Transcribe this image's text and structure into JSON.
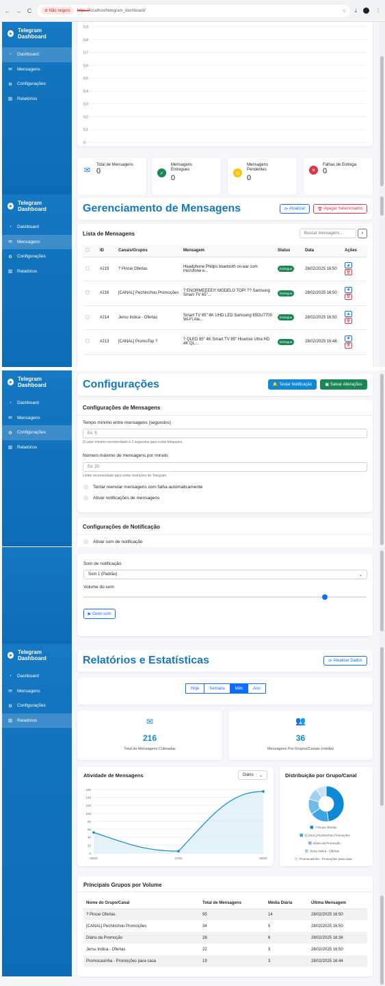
{
  "browser": {
    "not_secure": "Não seguro",
    "url_scheme": "https://",
    "url_rest": "localhost/telegram_dashboard/"
  },
  "sidebar": {
    "brand": "Telegram Dashboard",
    "items": [
      {
        "label": "Dashboard",
        "icon": "gauge-icon"
      },
      {
        "label": "Mensagens",
        "icon": "envelope-icon"
      },
      {
        "label": "Configurações",
        "icon": "gear-icon"
      },
      {
        "label": "Relatórios",
        "icon": "chart-icon"
      }
    ]
  },
  "dashboard": {
    "chart_data": {
      "type": "line",
      "y_ticks": [
        "0,9",
        "0,8",
        "0,7",
        "0,6",
        "0,5",
        "0,4",
        "0,3",
        "0,2",
        "0,1",
        "0"
      ],
      "ylim": [
        0,
        0.9
      ],
      "series": []
    },
    "stats": [
      {
        "label": "Total de Mensagens",
        "value": "0",
        "icon": "envelope-icon",
        "color": "#0d6efd"
      },
      {
        "label": "Mensagens Entregues",
        "value": "0",
        "icon": "check-icon",
        "color": "#198754"
      },
      {
        "label": "Mensagens Pendentes",
        "value": "0",
        "icon": "clock-icon",
        "color": "#ffc107"
      },
      {
        "label": "Falhas de Entrega",
        "value": "0",
        "icon": "x-icon",
        "color": "#dc3545"
      }
    ]
  },
  "messages": {
    "title": "Gerenciamento de Mensagens",
    "refresh_label": "Atualizar",
    "delete_selected_label": "Apagar Selecionados",
    "list_title": "Lista de Mensagens",
    "search_placeholder": "Buscar mensagens...",
    "columns": [
      "ID",
      "Canais/Grupos",
      "Mensagem",
      "Status",
      "Data",
      "Ações"
    ],
    "rows": [
      {
        "id": "#215",
        "channel": "? Pincei Ofertas",
        "message": "Headphone Philips bluetooth on-ear com microfone e...",
        "status": "Entregue",
        "date": "28/02/2025 16:50"
      },
      {
        "id": "#216",
        "channel": "[CANAL] Pechinchou Promoções",
        "message": "? ENORMEEEE!!! MODELO TOP! ?? Samsung Smart TV 65\"...",
        "status": "Entregue",
        "date": "28/02/2025 16:50"
      },
      {
        "id": "#214",
        "channel": "Jersu Indica - Ofertas",
        "message": "Smart TV 65\" 4K UHD LED Samsung 65DU7700 Wi-Fi Ale...",
        "status": "Entregue",
        "date": "28/02/2025 16:50"
      },
      {
        "id": "#213",
        "channel": "[CANAL] PromoTop ?",
        "message": "? QLED 85\" 4K Smart TV 85\" Hisense Ultra HD 4K QL...",
        "status": "Entregue",
        "date": "28/02/2025 16:48"
      }
    ]
  },
  "settings": {
    "title": "Configurações",
    "test_notification_label": "Testar Notificação",
    "save_label": "Salvar Alterações",
    "messages_section": "Configurações de Mensagens",
    "min_time_label": "Tempo mínimo entre mensagens (segundos)",
    "min_time_placeholder": "Ex: 5",
    "min_time_help": "O valor mínimo recomendado é 2 segundos para evitar bloqueios.",
    "max_per_minute_label": "Número máximo de mensagens por minuto",
    "max_per_minute_placeholder": "Ex: 20",
    "max_per_minute_help": "Limite recomendado para evitar restrições do Telegram.",
    "retry_label": "Tentar reenviar mensagens com falha automaticamente",
    "notify_label": "Ativar notificações de mensagens",
    "notification_section": "Configurações de Notificação",
    "sound_toggle_label": "Ativar som de notificação",
    "sound_label": "Som de notificação",
    "sound_value": "Som 1 (Padrão)",
    "volume_label": "Volume do som",
    "volume_level": 0.85,
    "listen_label": "Ouvir som"
  },
  "reports": {
    "title": "Relatórios e Estatísticas",
    "refresh_label": "Atualizar Dados",
    "tabs": [
      "Hoje",
      "Semana",
      "Mês",
      "Ano"
    ],
    "active_tab": "Mês",
    "total_value": "216",
    "total_label": "Total de Mensagens Coletadas",
    "avg_value": "36",
    "avg_label": "Mensagens Por Grupos/Canais (média)",
    "activity_title": "Atividade de Mensagens",
    "activity_select": "Diário",
    "distribution_title": "Distribuição por Grupo/Canal",
    "activity_chart": {
      "type": "area",
      "x": [
        "26/02",
        "27/02",
        "28/02"
      ],
      "values": [
        52,
        5,
        155
      ],
      "y_ticks": [
        "160",
        "140",
        "120",
        "100",
        "80",
        "60",
        "40",
        "20",
        "0"
      ],
      "ylim": [
        0,
        165
      ],
      "color": "#0d89d6"
    },
    "pie_chart": {
      "type": "pie",
      "slices": [
        {
          "name": "? Pincei Ofertas",
          "value": 95,
          "color": "#0d89d6"
        },
        {
          "name": "[CANAL] Pechinchou Promoções",
          "value": 34,
          "color": "#3ea4e3"
        },
        {
          "name": "Diário da Promoção",
          "value": 28,
          "color": "#6fbbea"
        },
        {
          "name": "Jersu Indica - Ofertas",
          "value": 22,
          "color": "#9fd1f0"
        },
        {
          "name": "Promocasinha - Promoções para casa",
          "value": 19,
          "color": "#c9e4f6"
        }
      ]
    },
    "top_title": "Principais Grupos por Volume",
    "top_columns": [
      "Nome do Grupo/Canal",
      "Total de Mensagens",
      "Média Diária",
      "Última Mensagem"
    ],
    "top_rows": [
      {
        "name": "? Pincei Ofertas",
        "total": "95",
        "avg": "14",
        "last": "28/02/2025 16:50"
      },
      {
        "name": "[CANAL] Pechinchou Promoções",
        "total": "34",
        "avg": "5",
        "last": "28/02/2025 16:50"
      },
      {
        "name": "Diário da Promoção",
        "total": "28",
        "avg": "6",
        "last": "28/02/2025 16:36"
      },
      {
        "name": "Jersu Indica - Ofertas",
        "total": "22",
        "avg": "3",
        "last": "28/02/2025 16:50"
      },
      {
        "name": "Promocasinha - Promoções para casa",
        "total": "19",
        "avg": "3",
        "last": "28/02/2025 16:44"
      }
    ]
  }
}
